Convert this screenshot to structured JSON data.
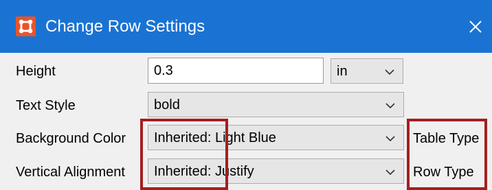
{
  "window": {
    "title": "Change Row Settings",
    "app_icon": "app-grid-icon",
    "close_icon": "close-icon",
    "title_bar_color": "#1a73d3",
    "app_icon_color": "#e8542a",
    "highlight_color": "#a31f1f"
  },
  "form": {
    "height": {
      "label": "Height",
      "value": "0.3",
      "unit": "in"
    },
    "text_style": {
      "label": "Text Style",
      "value": "bold"
    },
    "background_color": {
      "label": "Background Color",
      "value": "Inherited: Light Blue",
      "source": "Table Type"
    },
    "vertical_alignment": {
      "label": "Vertical Alignment",
      "value": "Inherited: Justify",
      "source": "Row Type"
    }
  }
}
